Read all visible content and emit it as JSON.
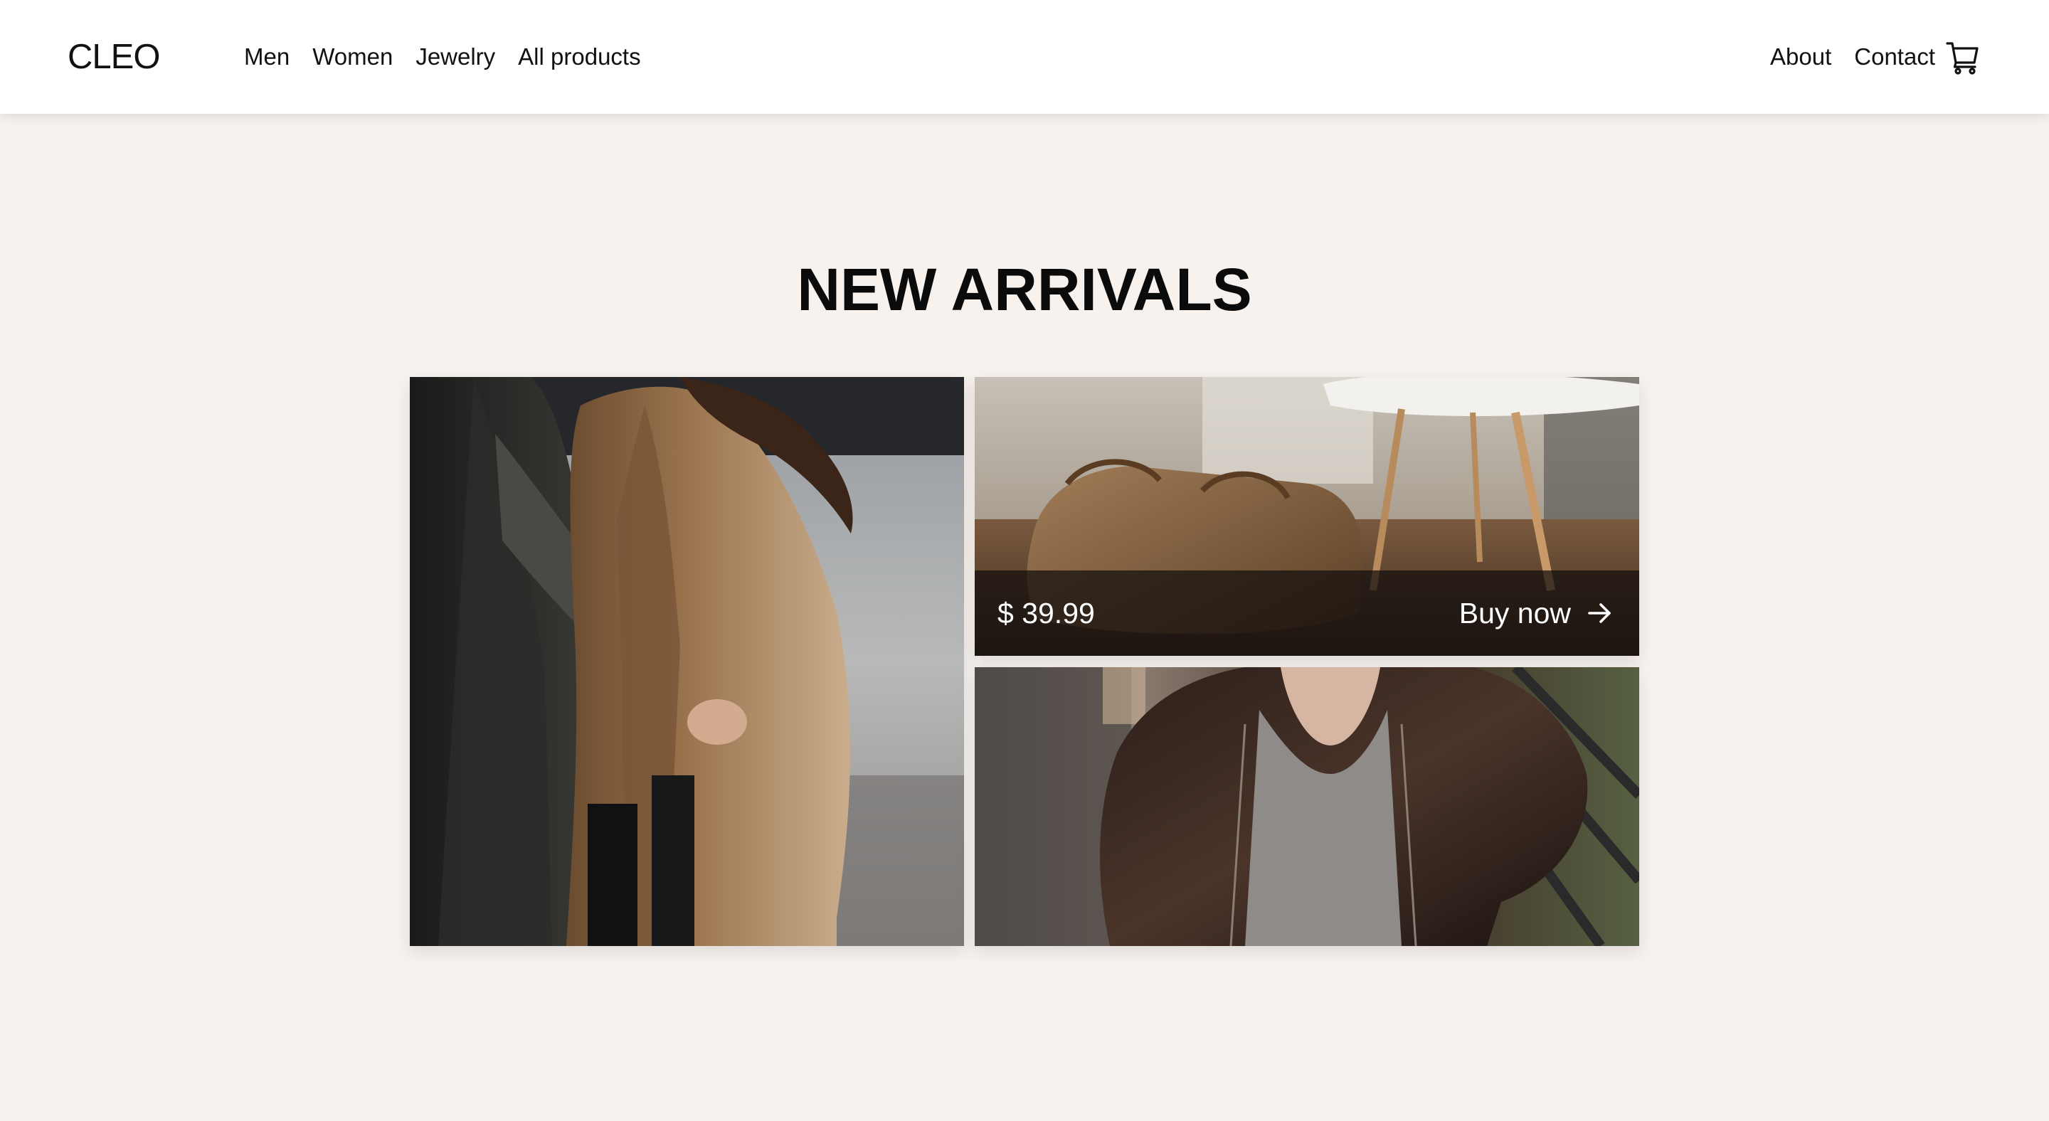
{
  "header": {
    "logo": "CLEO",
    "nav_left": [
      "Men",
      "Women",
      "Jewelry",
      "All products"
    ],
    "nav_right": [
      "About",
      "Contact"
    ],
    "cart_icon": "cart-icon"
  },
  "main": {
    "title": "NEW ARRIVALS",
    "featured": {
      "price": "$ 39.99",
      "cta_label": "Buy now",
      "cta_icon": "arrow-right-icon"
    }
  },
  "colors": {
    "page_background": "#f7f2ee",
    "header_background": "#ffffff",
    "overlay": "rgba(18,14,12,0.72)",
    "text": "#111111"
  }
}
